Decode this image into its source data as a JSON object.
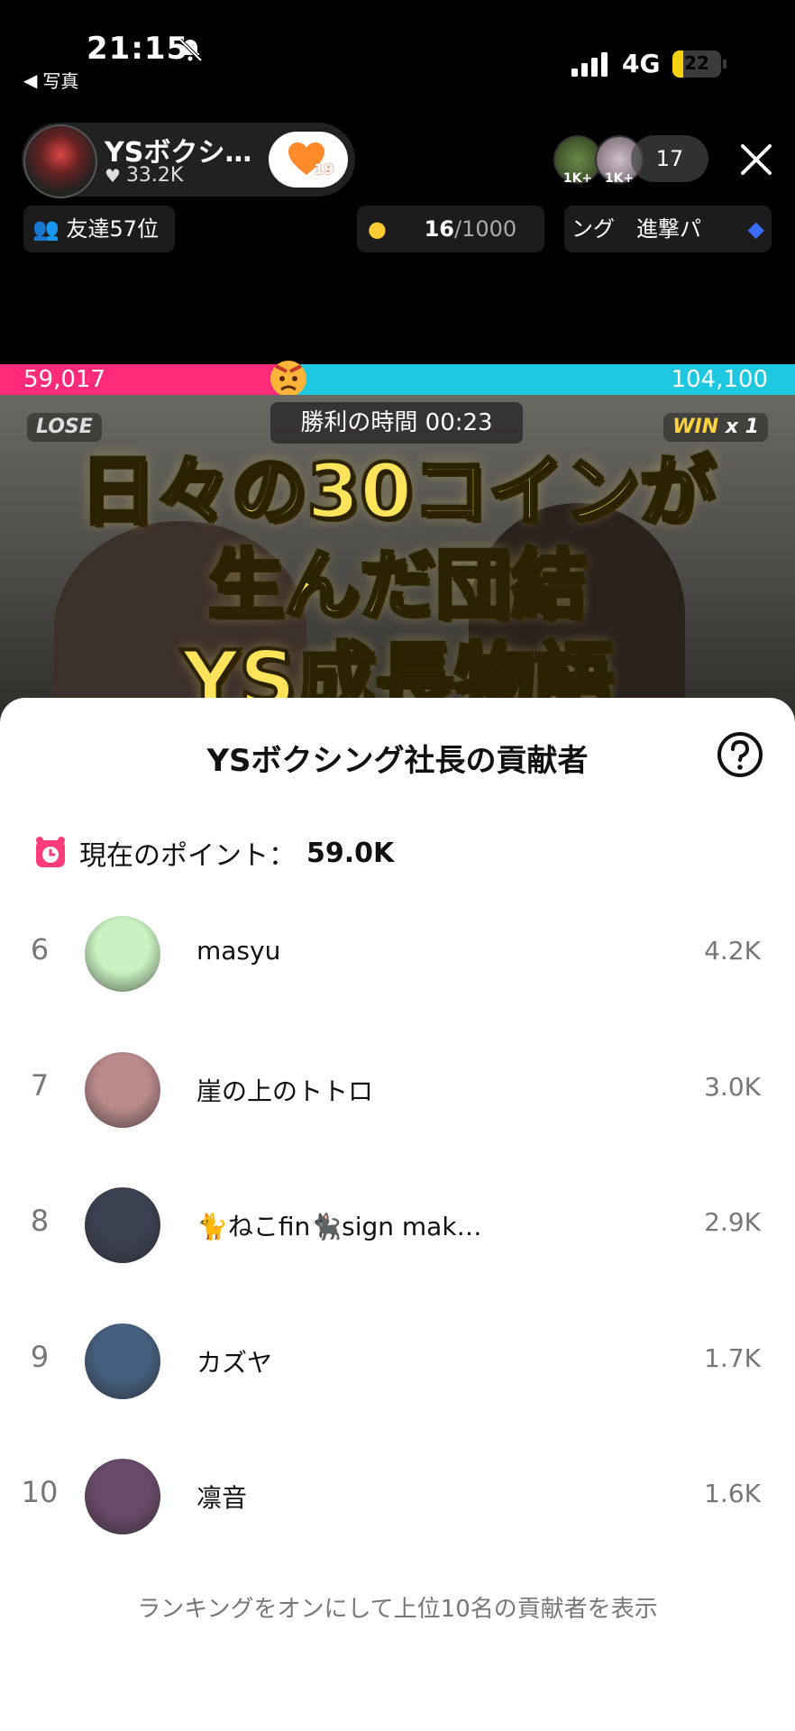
{
  "status_bar": {
    "time": "21:15",
    "back_app": "写真",
    "network": "4G",
    "battery": "22",
    "battery_level": 0.22
  },
  "host": {
    "name": "YSボクシ…",
    "likes": "33.2K",
    "follow_count": "19"
  },
  "viewers": {
    "badges": [
      "1K+",
      "1K+"
    ],
    "count": "17"
  },
  "info": {
    "friends_rank": "友達57位",
    "goal_current": "16",
    "goal_total": "/1000",
    "ranking_ticker": "ング　進撃パ"
  },
  "battle": {
    "left_score": "59,017",
    "right_score": "104,100",
    "left_share": 0.36,
    "timer": "勝利の時間  00:23",
    "lose": "LOSE",
    "win": "WIN",
    "win_mult": "x 1"
  },
  "caption": {
    "line1": "日々の30コインが",
    "line2": "生んだ団結",
    "line3": "YS成長物語"
  },
  "sheet": {
    "title": "YSボクシング社長の貢献者",
    "points_label": "現在のポイント：",
    "points_value": "59.0K",
    "footer": "ランキングをオンにして上位10名の貢献者を表示",
    "contributors": [
      {
        "rank": "6",
        "name": "masyu",
        "score": "4.2K",
        "color": "#c9f2c0"
      },
      {
        "rank": "7",
        "name": "崖の上のトトロ",
        "score": "3.0K",
        "color": "#b98a8a"
      },
      {
        "rank": "8",
        "name": "🐈ねこfin🐈‍⬛sign mak…",
        "score": "2.9K",
        "color": "#3c4152"
      },
      {
        "rank": "9",
        "name": "カズヤ",
        "score": "1.7K",
        "color": "#45607f"
      },
      {
        "rank": "10",
        "name": "凛音",
        "score": "1.6K",
        "color": "#6a4a6a"
      }
    ]
  },
  "colors": {
    "pink": "#ff2a78",
    "cyan": "#1ec8e0",
    "caption_gold": "#ffe35a"
  }
}
